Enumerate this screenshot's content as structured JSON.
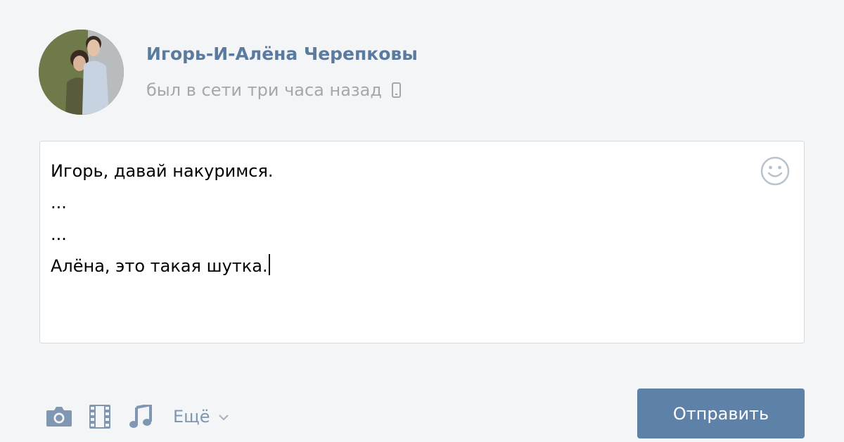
{
  "profile": {
    "name": "Игорь-И-Алёна Черепковы",
    "status": "был в сети три часа назад",
    "status_icon": "mobile-phone-icon"
  },
  "composer": {
    "lines": [
      "Игорь, давай накуримся.",
      "...",
      "...",
      "Алёна, это такая шутка."
    ],
    "emoji_icon": "smiley-icon"
  },
  "toolbar": {
    "icons": [
      "camera-icon",
      "video-icon",
      "music-icon"
    ],
    "more_label": "Ещё",
    "send_label": "Отправить"
  },
  "colors": {
    "background": "#f4f5f7",
    "name": "#5b7a9f",
    "status": "#a3a8ae",
    "icon": "#7f97b2",
    "button": "#5e81a8",
    "button_text": "#ffffff"
  }
}
